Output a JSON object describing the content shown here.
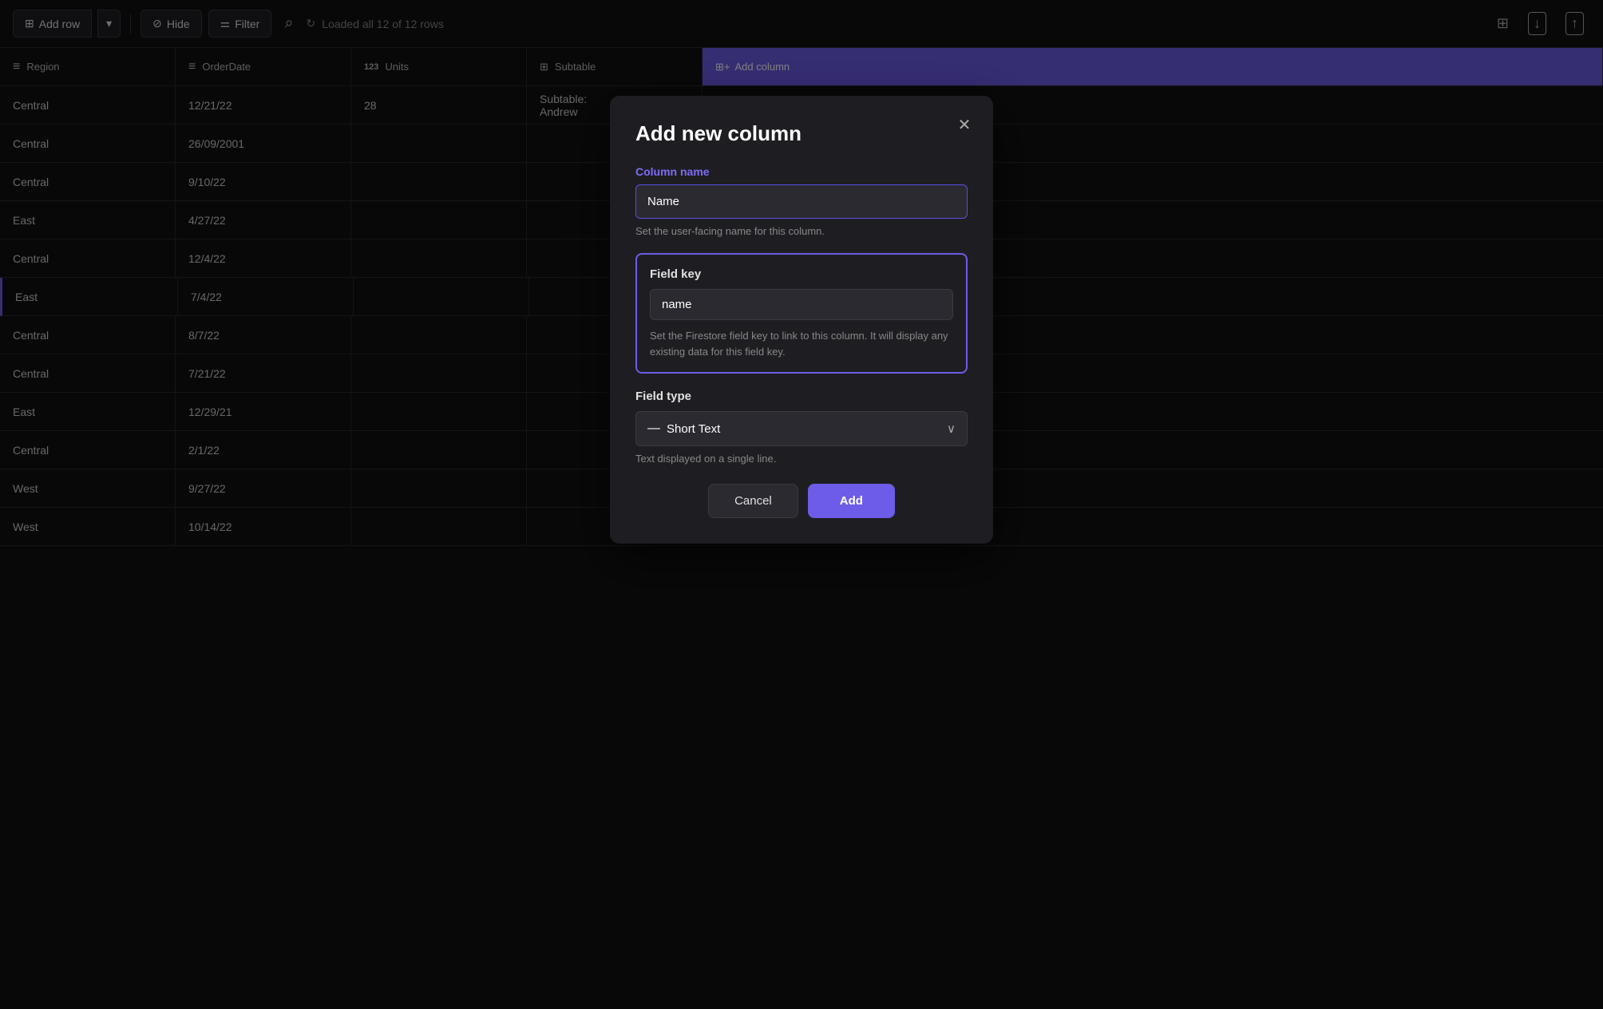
{
  "toolbar": {
    "add_row_label": "Add row",
    "hide_label": "Hide",
    "filter_label": "Filter",
    "status_label": "Loaded all 12 of 12 rows"
  },
  "table": {
    "columns": [
      {
        "id": "region",
        "label": "Region",
        "type": "lines"
      },
      {
        "id": "orderdate",
        "label": "OrderDate",
        "type": "lines"
      },
      {
        "id": "units",
        "label": "Units",
        "type": "123"
      },
      {
        "id": "subtable",
        "label": "Subtable",
        "type": "subtable"
      }
    ],
    "add_column_label": "Add column",
    "rows": [
      {
        "region": "Central",
        "orderdate": "12/21/22",
        "units": "28",
        "subtable": "Subtable: Andrew"
      },
      {
        "region": "Central",
        "orderdate": "26/09/2001",
        "units": "",
        "subtable": ""
      },
      {
        "region": "Central",
        "orderdate": "9/10/22",
        "units": "",
        "subtable": ""
      },
      {
        "region": "East",
        "orderdate": "4/27/22",
        "units": "",
        "subtable": ""
      },
      {
        "region": "Central",
        "orderdate": "12/4/22",
        "units": "",
        "subtable": ""
      },
      {
        "region": "East",
        "orderdate": "7/4/22",
        "units": "",
        "subtable": "",
        "active": true
      },
      {
        "region": "Central",
        "orderdate": "8/7/22",
        "units": "",
        "subtable": ""
      },
      {
        "region": "Central",
        "orderdate": "7/21/22",
        "units": "",
        "subtable": ""
      },
      {
        "region": "East",
        "orderdate": "12/29/21",
        "units": "",
        "subtable": ""
      },
      {
        "region": "Central",
        "orderdate": "2/1/22",
        "units": "",
        "subtable": ""
      },
      {
        "region": "West",
        "orderdate": "9/27/22",
        "units": "",
        "subtable": ""
      },
      {
        "region": "West",
        "orderdate": "10/14/22",
        "units": "",
        "subtable": ""
      }
    ]
  },
  "modal": {
    "title": "Add new column",
    "column_name_label": "Column name",
    "column_name_value": "Name",
    "column_name_placeholder": "Name",
    "column_name_hint": "Set the user-facing name for this column.",
    "field_key_label": "Field key",
    "field_key_value": "name",
    "field_key_hint": "Set the Firestore field key to link to this column. It will display any existing data for this field key.",
    "field_type_label": "Field type",
    "field_type_value": "Short Text",
    "field_type_hint": "Text displayed on a single line.",
    "cancel_label": "Cancel",
    "add_label": "Add"
  },
  "icons": {
    "add_row": "⊞+",
    "hide": "⊘",
    "filter": "⚌",
    "search": "⌕",
    "refresh": "↻",
    "grid": "⊞",
    "download": "↓",
    "share": "↑",
    "trash": "⬜",
    "more": "⋯",
    "copy": "⧉",
    "upload": "⬆",
    "chevron_down": "∨",
    "short_text": "—",
    "close": "✕",
    "lines": "≡",
    "123": "123",
    "subtable_icon": "⊞"
  }
}
